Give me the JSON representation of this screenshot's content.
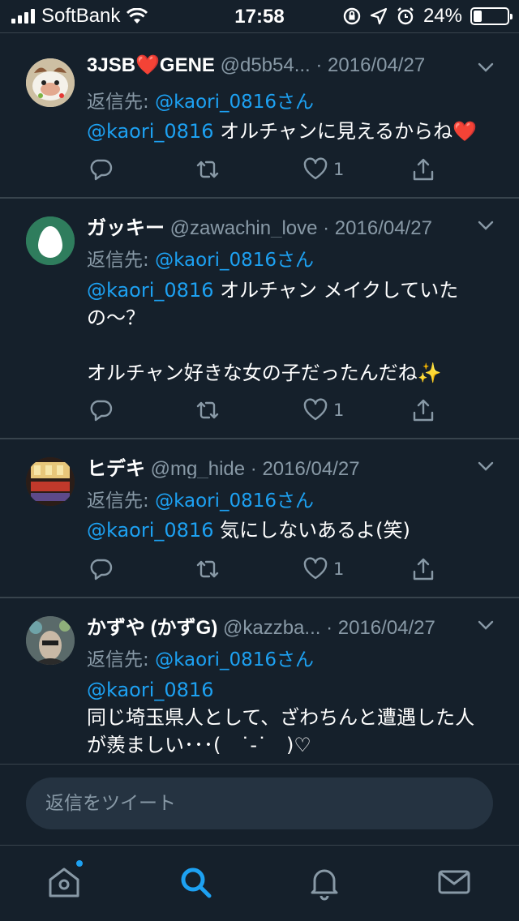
{
  "status_bar": {
    "carrier": "SoftBank",
    "time": "17:58",
    "battery": "24%",
    "battery_fraction": 0.24
  },
  "colors": {
    "background": "#15202b",
    "accent": "#1da1f2",
    "secondary_text": "#8899a6",
    "divider": "#38444d"
  },
  "tweets": [
    {
      "name": "3JSB❤️GENE",
      "handle": "@d5b54...",
      "date": "· 2016/04/27",
      "reply_label": "返信先: ",
      "reply_mention": "@kaori_0816さん",
      "mention": "@kaori_0816",
      "text": " オルチャンに見えるからね❤️",
      "like_count": "1",
      "avatar_icon": "cartoon-food-avatar"
    },
    {
      "name": "ガッキー",
      "handle": "@zawachin_love",
      "date": "· 2016/04/27",
      "reply_label": "返信先: ",
      "reply_mention": "@kaori_0816さん",
      "mention": "@kaori_0816",
      "text": " オルチャン メイクしていたの〜？\n\nオルチャン好きな女の子だったんだね✨",
      "like_count": "1",
      "avatar_icon": "egg-avatar"
    },
    {
      "name": "ヒデキ",
      "handle": "@mg_hide",
      "date": "· 2016/04/27",
      "reply_label": "返信先: ",
      "reply_mention": "@kaori_0816さん",
      "mention": "@kaori_0816",
      "text": " 気にしないあるよ(笑)",
      "like_count": "1",
      "avatar_icon": "arcade-photo-avatar"
    },
    {
      "name": "かずや (かずG)",
      "handle": "@kazzba...",
      "date": "· 2016/04/27",
      "reply_label": "返信先: ",
      "reply_mention": "@kaori_0816さん",
      "mention": "@kaori_0816",
      "text": "\n同じ埼玉県人として、ざわちんと遭遇した人が羨ましい･･･(　˙-˙　)♡",
      "like_count": "",
      "avatar_icon": "face-photo-avatar"
    }
  ],
  "composer": {
    "placeholder": "返信をツイート"
  },
  "tabs": [
    "home-icon",
    "search-icon",
    "notifications-icon",
    "messages-icon"
  ]
}
